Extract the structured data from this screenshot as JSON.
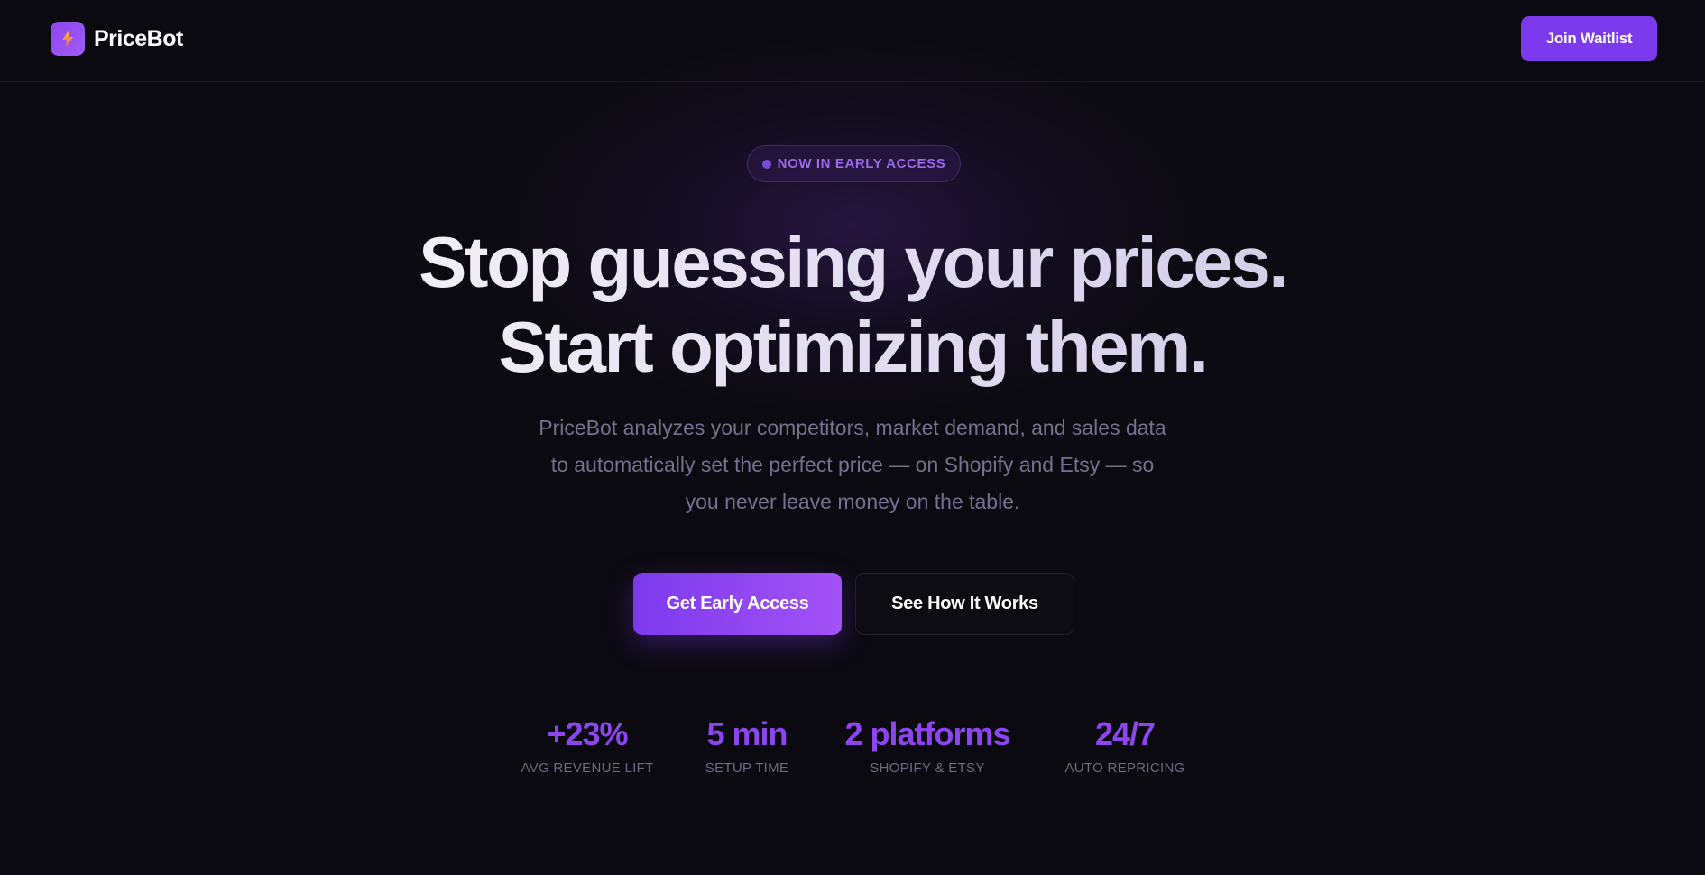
{
  "header": {
    "brand_name": "PriceBot",
    "logo_icon": "lightning-bolt-icon",
    "cta_label": "Join Waitlist"
  },
  "hero": {
    "badge": "NOW IN EARLY ACCESS",
    "headline_line1": "Stop guessing your prices.",
    "headline_line2": "Start optimizing them.",
    "subtext": "PriceBot analyzes your competitors, market demand, and sales data to automatically set the perfect price — on Shopify and Etsy — so you never leave money on the table.",
    "primary_cta": "Get Early Access",
    "secondary_cta": "See How It Works"
  },
  "stats": [
    {
      "value": "+23%",
      "label": "AVG REVENUE LIFT"
    },
    {
      "value": "5 min",
      "label": "SETUP TIME"
    },
    {
      "value": "2 platforms",
      "label": "SHOPIFY & ETSY"
    },
    {
      "value": "24/7",
      "label": "AUTO REPRICING"
    }
  ],
  "colors": {
    "background": "#0b0a10",
    "accent": "#7c3aed",
    "accent_light": "#a352f5",
    "stat_value": "#8d46ee",
    "muted_text": "#77708f"
  }
}
